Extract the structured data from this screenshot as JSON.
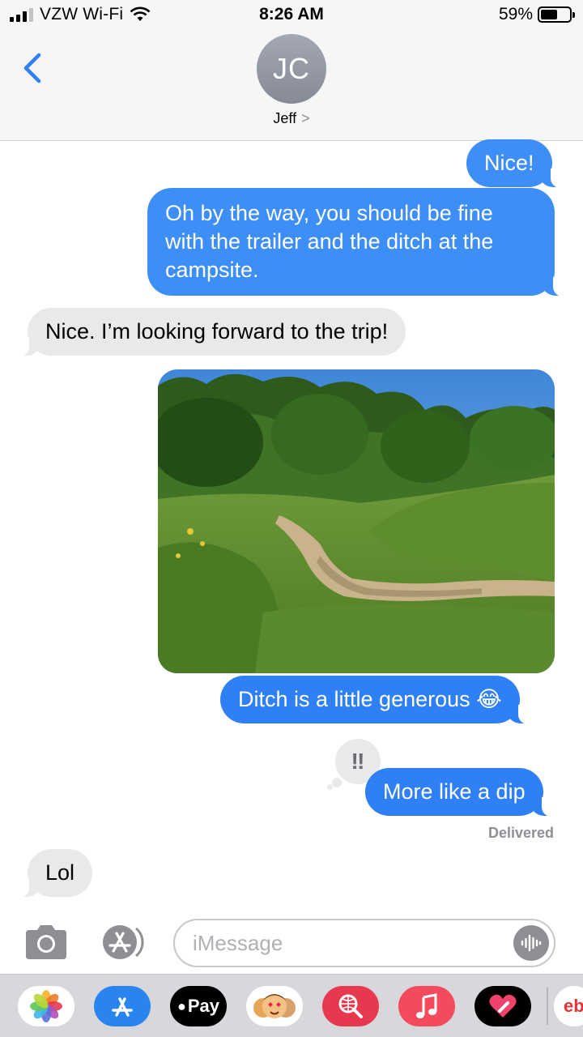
{
  "status_bar": {
    "carrier": "VZW Wi-Fi",
    "time": "8:26 AM",
    "battery_percent": "59%",
    "battery_level": 0.59
  },
  "header": {
    "avatar_initials": "JC",
    "contact_name": "Jeff",
    "chevron": ">"
  },
  "messages": [
    {
      "from": "me",
      "text": "Nice!"
    },
    {
      "from": "me",
      "text": "Oh by the way, you should be fine with the trailer and the ditch at the campsite."
    },
    {
      "from": "them",
      "text": "Nice. I’m looking forward to the trip!"
    },
    {
      "from": "me",
      "type": "photo"
    },
    {
      "from": "me",
      "text": "Ditch is a little generous 😂"
    },
    {
      "from": "me",
      "text": "More like a dip",
      "reaction": "‼"
    }
  ],
  "delivered_label": "Delivered",
  "incoming_last": {
    "text": "Lol"
  },
  "input": {
    "placeholder": "iMessage"
  },
  "app_drawer": {
    "apple_pay_label": "Pay",
    "icons": [
      "photos-icon",
      "app-store-icon",
      "apple-pay-icon",
      "memoji-icon",
      "search-images-icon",
      "music-icon",
      "digital-touch-icon",
      "ebay-icon"
    ],
    "partial_label": "eb"
  },
  "colors": {
    "outgoing": "#3e8ef7",
    "incoming": "#e9e9eb",
    "accent": "#2f7ff5"
  }
}
